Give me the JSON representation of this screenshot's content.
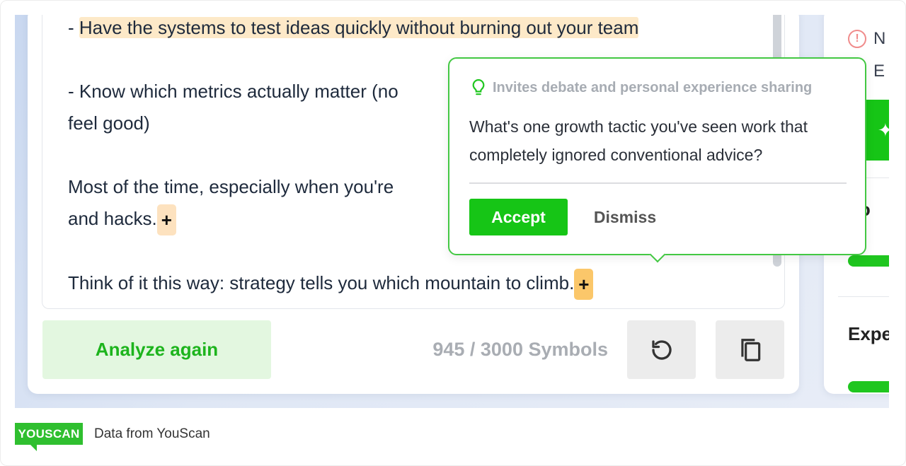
{
  "editor": {
    "lines": {
      "l1_prefix": "- ",
      "l1_highlight": "Have the systems to test ideas quickly without burning out your team",
      "l2a": "- Know which metrics actually matter (no",
      "l2b": "feel good)",
      "l3a": "Most of the time, especially when you're",
      "l3b": "and hacks.",
      "l4": "Think of it this way: strategy tells you which mountain to climb."
    },
    "plus_marker": "+"
  },
  "toolbar": {
    "analyze_label": "Analyze again",
    "symbols_count": "945 / 3000 Symbols",
    "refresh_icon": "refresh-icon",
    "copy_icon": "copy-icon"
  },
  "popover": {
    "category": "Invites debate and personal experience sharing",
    "suggestion": "What's one growth tactic you've seen work that completely ignored conventional advice?",
    "accept_label": "Accept",
    "dismiss_label": "Dismiss",
    "icon": "lightbulb-icon"
  },
  "side_panel": {
    "row1": "N",
    "row2": "E",
    "section1": "go",
    "section2": "Expe"
  },
  "footer": {
    "logo": "YOUSCAN",
    "caption": "Data from YouScan"
  },
  "colors": {
    "accent_green": "#16c516",
    "highlight": "#fde9c8",
    "active_marker": "#fbc76a"
  }
}
